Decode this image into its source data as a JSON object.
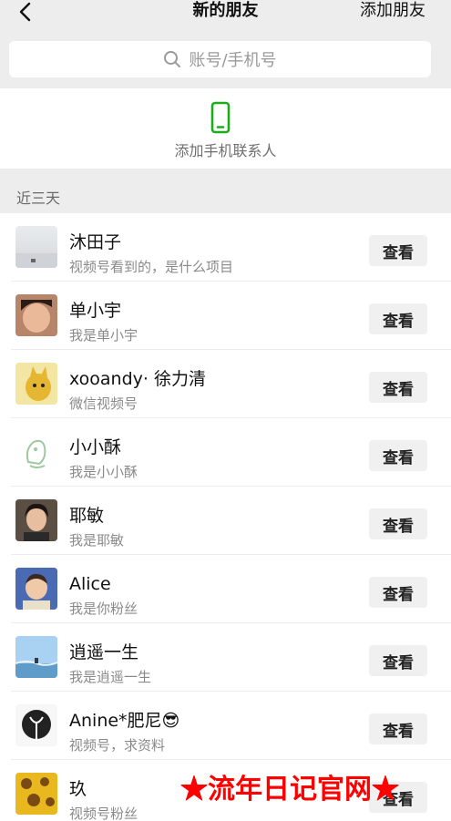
{
  "header": {
    "title": "新的朋友",
    "add_friends": "添加朋友"
  },
  "search": {
    "placeholder": "账号/手机号"
  },
  "add_phone_contacts": {
    "label": "添加手机联系人",
    "icon": "phone-icon",
    "accent": "#1aad19"
  },
  "section": {
    "title": "近三天"
  },
  "friends": [
    {
      "name": "沐田子",
      "subtitle": "视频号看到的，是什么项目",
      "action": "查看"
    },
    {
      "name": "单小宇",
      "subtitle": "我是单小宇",
      "action": "查看"
    },
    {
      "name": "xooandy· 徐力清",
      "subtitle": "微信视频号",
      "action": "查看"
    },
    {
      "name": "小小酥",
      "subtitle": "我是小小酥",
      "action": "查看"
    },
    {
      "name": "耶敏",
      "subtitle": "我是耶敏",
      "action": "查看"
    },
    {
      "name": "Alice",
      "subtitle": "我是你粉丝",
      "action": "查看"
    },
    {
      "name": "逍遥一生",
      "subtitle": "我是逍遥一生",
      "action": "查看"
    },
    {
      "name": "Anine*肥尼😎",
      "subtitle": "视频号，求资料",
      "action": "查看"
    },
    {
      "name": "玖",
      "subtitle": "视频号粉丝",
      "action": "查看"
    }
  ],
  "watermark": "★流年日记官网★"
}
